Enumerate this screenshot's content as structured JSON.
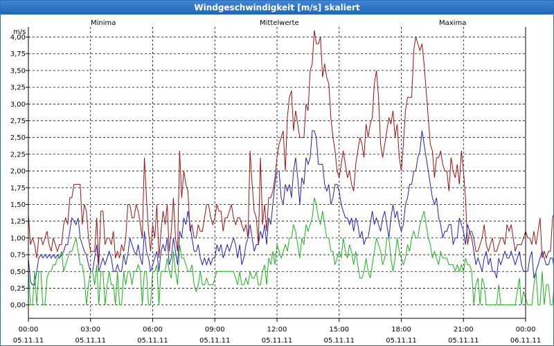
{
  "window": {
    "title": "Windgeschwindigkeit [m/s] skaliert"
  },
  "legend": {
    "min_label": "Minima",
    "min_color": "#17b317",
    "mean_label": "Mittelwerte",
    "mean_color": "#1f1fb8",
    "max_label": "Maxima",
    "max_color": "#a01010"
  },
  "chart_data": {
    "type": "line",
    "title": "Windgeschwindigkeit [m/s] skaliert",
    "ylabel": "m/s",
    "ylim": [
      -0.2,
      4.15
    ],
    "yticks": [
      "0,00",
      "0,25",
      "0,50",
      "0,75",
      "1,00",
      "1,25",
      "1,50",
      "1,75",
      "2,00",
      "2,25",
      "2,50",
      "2,75",
      "3,00",
      "3,25",
      "3,50",
      "3,75",
      "4,00"
    ],
    "xlim": [
      0,
      24
    ],
    "xticks": [
      {
        "time": "00:00",
        "date": "05.11.11"
      },
      {
        "time": "03:00",
        "date": "05.11.11"
      },
      {
        "time": "06:00",
        "date": "05.11.11"
      },
      {
        "time": "09:00",
        "date": "05.11.11"
      },
      {
        "time": "12:00",
        "date": "05.11.11"
      },
      {
        "time": "15:00",
        "date": "05.11.11"
      },
      {
        "time": "18:00",
        "date": "05.11.11"
      },
      {
        "time": "21:00",
        "date": "05.11.11"
      },
      {
        "time": "00:00",
        "date": "06.11.11"
      }
    ],
    "grid": true,
    "step_hours": 0.1,
    "series": [
      {
        "name": "Maxima",
        "color": "#a01010",
        "values": [
          1.35,
          0.9,
          1.0,
          0.9,
          0.7,
          1.0,
          1.0,
          0.9,
          1.0,
          1.1,
          0.9,
          0.8,
          1.0,
          0.9,
          0.8,
          0.9,
          0.9,
          1.2,
          1.3,
          1.2,
          1.6,
          1.6,
          1.8,
          1.8,
          1.8,
          1.8,
          1.2,
          1.5,
          1.4,
          1.0,
          0.8,
          0.8,
          0.8,
          1.3,
          0.6,
          1.4,
          1.4,
          0.9,
          1.0,
          1.0,
          0.9,
          1.1,
          0.7,
          0.8,
          0.7,
          0.9,
          0.8,
          1.0,
          1.5,
          1.5,
          1.3,
          1.3,
          1.5,
          1.4,
          1.2,
          1.0,
          2.2,
          1.6,
          1.1,
          0.8,
          1.2,
          1.0,
          1.5,
          0.7,
          1.1,
          1.4,
          1.2,
          1.5,
          0.8,
          1.1,
          1.6,
          1.0,
          0.8,
          2.3,
          1.6,
          2.0,
          1.8,
          1.7,
          1.1,
          1.2,
          1.0,
          1.0,
          1.2,
          1.1,
          1.1,
          1.3,
          1.5,
          1.5,
          1.3,
          1.2,
          1.3,
          1.5,
          1.4,
          1.4,
          1.1,
          1.3,
          1.3,
          1.4,
          1.5,
          1.3,
          1.2,
          1.3,
          1.3,
          1.2,
          1.1,
          1.2,
          1.0,
          2.3,
          1.8,
          1.4,
          1.3,
          0.9,
          2.2,
          1.2,
          1.5,
          1.1,
          1.6,
          1.6,
          1.7,
          1.9,
          2.2,
          2.4,
          2.5,
          2.6,
          2.0,
          2.8,
          3.1,
          3.2,
          2.6,
          2.9,
          2.7,
          2.5,
          2.5,
          2.5,
          3.0,
          2.9,
          3.5,
          3.6,
          4.1,
          3.9,
          3.9,
          4.0,
          3.4,
          3.6,
          3.4,
          3.3,
          2.8,
          2.5,
          2.3,
          2.0,
          1.9,
          2.1,
          2.3,
          2.1,
          1.9,
          2.0,
          1.8,
          1.7,
          2.1,
          2.3,
          2.5,
          2.4,
          2.2,
          2.7,
          2.5,
          2.7,
          2.8,
          3.3,
          3.5,
          3.1,
          2.4,
          2.2,
          2.4,
          2.6,
          2.8,
          2.7,
          2.9,
          2.5,
          2.7,
          2.2,
          2.0,
          2.4,
          2.9,
          3.1,
          3.1,
          3.1,
          3.8,
          4.0,
          3.9,
          3.8,
          3.9,
          3.6,
          3.2,
          2.8,
          2.4,
          2.3,
          1.9,
          2.2,
          2.2,
          2.3,
          2.1,
          2.0,
          2.0,
          1.7,
          2.2,
          2.0,
          1.9,
          2.1,
          1.8,
          2.3,
          2.0,
          1.6,
          0.9,
          1.1,
          1.1,
          1.0,
          0.8,
          0.8,
          0.9,
          1.0,
          1.2,
          0.9,
          0.8,
          0.9,
          1.0,
          0.8,
          0.8,
          0.9,
          1.0,
          1.0,
          0.9,
          1.2,
          1.1,
          1.2,
          1.0,
          0.8,
          0.9,
          0.9,
          0.9,
          1.0,
          1.1,
          1.0,
          1.0,
          0.9,
          1.1,
          0.9,
          1.1,
          1.3,
          0.7,
          0.8,
          0.7,
          0.8,
          0.8,
          1.3,
          1.4,
          1.2,
          1.3,
          1.5,
          1.2,
          1.0,
          1.4,
          1.5,
          1.4,
          1.3,
          1.3,
          1.0,
          1.1,
          1.2,
          1.2,
          1.0,
          0.9,
          1.3,
          1.0,
          1.1,
          1.4,
          1.2,
          0.8
        ]
      },
      {
        "name": "Mittelwerte",
        "color": "#1f1fb8",
        "values": [
          0.7,
          0.35,
          0.3,
          0.3,
          0.5,
          0.7,
          0.75,
          0.7,
          0.75,
          0.7,
          0.75,
          0.7,
          0.75,
          0.7,
          0.75,
          0.7,
          0.75,
          0.8,
          0.9,
          0.9,
          1.1,
          1.3,
          1.25,
          1.2,
          1.3,
          1.0,
          0.9,
          0.8,
          0.75,
          0.6,
          0.5,
          0.5,
          0.7,
          0.9,
          0.5,
          0.6,
          0.7,
          0.6,
          0.7,
          0.8,
          0.7,
          0.5,
          0.5,
          0.6,
          0.5,
          0.5,
          0.75,
          0.6,
          0.75,
          1.0,
          0.9,
          0.8,
          0.75,
          0.9,
          0.7,
          0.6,
          1.1,
          0.8,
          0.7,
          0.5,
          0.6,
          0.7,
          0.8,
          0.5,
          0.8,
          0.9,
          0.8,
          1.0,
          0.6,
          0.7,
          1.0,
          0.8,
          0.6,
          1.1,
          1.0,
          1.3,
          1.2,
          1.4,
          1.2,
          1.0,
          0.8,
          0.8,
          0.9,
          0.7,
          0.6,
          0.7,
          0.6,
          0.7,
          0.6,
          0.7,
          0.7,
          0.9,
          0.8,
          0.9,
          0.7,
          0.8,
          0.9,
          0.8,
          0.9,
          1.0,
          0.9,
          0.7,
          0.9,
          0.6,
          0.7,
          0.9,
          1.0,
          1.2,
          1.0,
          0.8,
          0.9,
          0.9,
          1.1,
          1.0,
          1.2,
          0.9,
          1.3,
          1.2,
          1.5,
          1.8,
          2.0,
          2.0,
          1.6,
          1.5,
          1.8,
          1.7,
          1.8,
          1.6,
          2.0,
          2.2,
          1.9,
          1.5,
          1.9,
          1.8,
          2.2,
          2.1,
          2.2,
          2.6,
          2.6,
          2.5,
          2.1,
          2.1,
          2.1,
          1.8,
          1.7,
          1.8,
          1.5,
          1.6,
          1.8,
          1.8,
          1.7,
          1.5,
          1.4,
          1.3,
          1.3,
          1.2,
          1.3,
          1.1,
          1.3,
          1.2,
          1.0,
          1.1,
          0.9,
          1.0,
          1.0,
          1.2,
          1.4,
          1.2,
          1.3,
          1.2,
          1.1,
          1.3,
          1.4,
          1.2,
          1.0,
          1.3,
          1.5,
          1.3,
          1.4,
          1.2,
          1.1,
          1.2,
          1.5,
          1.6,
          1.8,
          1.8,
          2.0,
          2.0,
          2.2,
          2.3,
          2.6,
          2.4,
          2.2,
          2.0,
          1.8,
          1.6,
          1.5,
          1.6,
          1.3,
          1.2,
          1.0,
          1.1,
          1.1,
          1.2,
          1.2,
          0.9,
          1.0,
          1.0,
          1.3,
          1.2,
          1.1,
          0.9,
          1.2,
          1.1,
          1.0,
          0.8,
          0.6,
          0.7,
          0.6,
          0.5,
          0.7,
          0.8,
          0.6,
          0.7,
          0.5,
          0.5,
          0.4,
          0.7,
          0.6,
          0.7,
          0.8,
          0.7,
          0.7,
          0.8,
          0.7,
          0.6,
          0.7,
          0.8,
          0.6,
          0.5,
          0.5,
          0.5,
          0.7,
          0.8,
          0.4,
          0.5,
          0.6,
          0.7,
          0.8,
          0.7,
          0.6,
          0.6,
          0.7,
          0.7,
          0.5,
          0.6,
          0.5,
          0.7,
          0.8,
          1.0,
          0.8,
          0.7,
          0.8,
          0.9,
          0.8,
          0.9,
          0.7,
          0.9,
          0.7,
          0.7,
          0.9,
          0.5,
          0.6,
          0.7,
          0.9,
          1.0,
          0.8,
          1.0,
          0.5,
          0.6
        ]
      },
      {
        "name": "Minima",
        "color": "#17b317",
        "values": [
          0.5,
          0.0,
          0.0,
          0.5,
          0.0,
          0.5,
          0.5,
          0.0,
          0.0,
          0.4,
          0.5,
          0.5,
          0.6,
          0.6,
          0.7,
          0.7,
          0.8,
          0.5,
          0.6,
          0.7,
          0.8,
          0.8,
          0.9,
          1.0,
          0.8,
          0.6,
          0.6,
          0.4,
          0.0,
          0.3,
          0.5,
          0.5,
          0.3,
          0.6,
          0.0,
          0.5,
          0.5,
          0.0,
          0.3,
          0.5,
          0.3,
          0.3,
          0.0,
          0.5,
          0.0,
          0.0,
          0.5,
          0.3,
          0.5,
          0.5,
          0.3,
          0.5,
          0.5,
          0.6,
          0.5,
          0.0,
          0.5,
          0.5,
          0.0,
          0.0,
          0.5,
          0.5,
          0.6,
          0.0,
          0.5,
          0.5,
          0.5,
          0.7,
          0.5,
          0.4,
          0.8,
          0.5,
          0.3,
          0.9,
          0.7,
          0.7,
          0.6,
          0.5,
          0.5,
          0.6,
          0.3,
          0.2,
          0.3,
          0.5,
          0.3,
          0.3,
          0.4,
          0.3,
          0.3,
          0.3,
          0.4,
          0.5,
          0.5,
          0.5,
          0.5,
          0.5,
          0.5,
          0.5,
          0.5,
          0.5,
          0.4,
          0.3,
          0.5,
          0.3,
          0.3,
          0.4,
          0.3,
          0.5,
          0.4,
          0.4,
          0.5,
          0.3,
          0.3,
          0.5,
          0.6,
          0.3,
          0.7,
          0.6,
          0.8,
          0.6,
          0.9,
          0.8,
          0.7,
          0.8,
          0.9,
          0.8,
          1.0,
          1.0,
          1.2,
          1.1,
          0.9,
          0.7,
          1.0,
          0.9,
          1.2,
          1.1,
          1.2,
          1.3,
          1.6,
          1.5,
          1.3,
          1.2,
          1.4,
          1.2,
          1.0,
          1.0,
          0.8,
          0.8,
          0.6,
          0.7,
          0.8,
          0.7,
          1.0,
          0.8,
          0.7,
          0.9,
          0.8,
          0.6,
          0.8,
          0.6,
          0.4,
          0.4,
          0.5,
          0.7,
          0.5,
          0.4,
          0.6,
          0.8,
          1.0,
          0.9,
          0.8,
          0.6,
          0.7,
          1.0,
          1.0,
          0.7,
          0.5,
          0.7,
          1.0,
          0.8,
          0.7,
          0.6,
          0.7,
          0.9,
          0.8,
          1.0,
          1.1,
          1.0,
          1.0,
          1.2,
          1.3,
          1.4,
          1.2,
          1.0,
          0.9,
          0.7,
          0.8,
          0.7,
          0.6,
          0.8,
          0.7,
          0.7,
          0.7,
          0.6,
          0.6,
          0.6,
          0.5,
          0.6,
          0.5,
          0.6,
          0.5,
          0.7,
          0.6,
          0.6,
          0.5,
          0.0,
          0.3,
          0.4,
          0.0,
          0.4,
          0.3,
          0.0,
          0.0,
          0.0,
          0.0,
          0.0,
          0.0,
          0.3,
          0.0,
          0.0,
          0.0,
          0.0,
          0.0,
          0.0,
          0.0,
          0.0,
          0.2,
          0.4,
          0.0,
          0.2,
          0.1,
          0.0,
          0.0,
          0.0,
          0.3,
          0.5,
          0.0,
          0.0,
          0.5,
          0.0,
          0.3,
          0.3,
          0.0,
          0.0,
          0.4,
          0.5,
          0.0,
          0.0,
          0.2,
          0.5,
          0.5,
          0.5,
          0.3,
          0.0,
          0.2,
          0.3,
          0.5,
          0.5,
          0.5,
          0.5,
          0.5,
          0.5,
          0.5,
          0.3,
          0.5,
          0.5,
          0.5,
          0.6,
          0.6,
          0.0,
          0.4,
          0.5
        ]
      }
    ]
  }
}
